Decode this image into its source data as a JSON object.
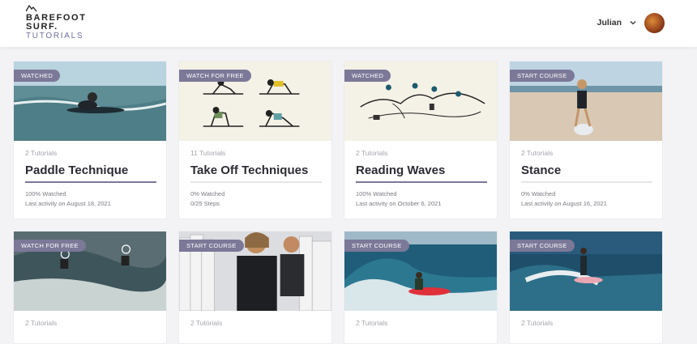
{
  "brand": {
    "line1": "BAREFOOT",
    "line2": "SURF.",
    "line3": "TUTORIALS"
  },
  "user": {
    "name": "Julian",
    "menu_icon": "chevron-down-icon",
    "avatar_icon": "user-avatar"
  },
  "colors": {
    "accent": "#7b7898",
    "page_bg": "#f3f3f5"
  },
  "courses": [
    {
      "badge": "WATCHED",
      "tutorials": "2 Tutorials",
      "title": "Paddle Technique",
      "progress": 1.0,
      "status": "100% Watched",
      "activity": "Last activity on August 18, 2021",
      "steps": ""
    },
    {
      "badge": "WATCH FOR FREE",
      "tutorials": "11 Tutorials",
      "title": "Take Off Techniques",
      "progress": 0.0,
      "status": "0% Watched",
      "activity": "",
      "steps": "0/25 Steps"
    },
    {
      "badge": "WATCHED",
      "tutorials": "2 Tutorials",
      "title": "Reading Waves",
      "progress": 1.0,
      "status": "100% Watched",
      "activity": "Last activity on October 6, 2021",
      "steps": ""
    },
    {
      "badge": "START COURSE",
      "tutorials": "2 Tutorials",
      "title": "Stance",
      "progress": 0.0,
      "status": "0% Watched",
      "activity": "Last activity on August 16, 2021",
      "steps": ""
    },
    {
      "badge": "WATCH FOR FREE",
      "tutorials": "2 Tutorials"
    },
    {
      "badge": "START COURSE",
      "tutorials": "2 Tutorials"
    },
    {
      "badge": "START COURSE",
      "tutorials": "2 Tutorials"
    },
    {
      "badge": "START COURSE",
      "tutorials": "2 Tutorials"
    }
  ]
}
